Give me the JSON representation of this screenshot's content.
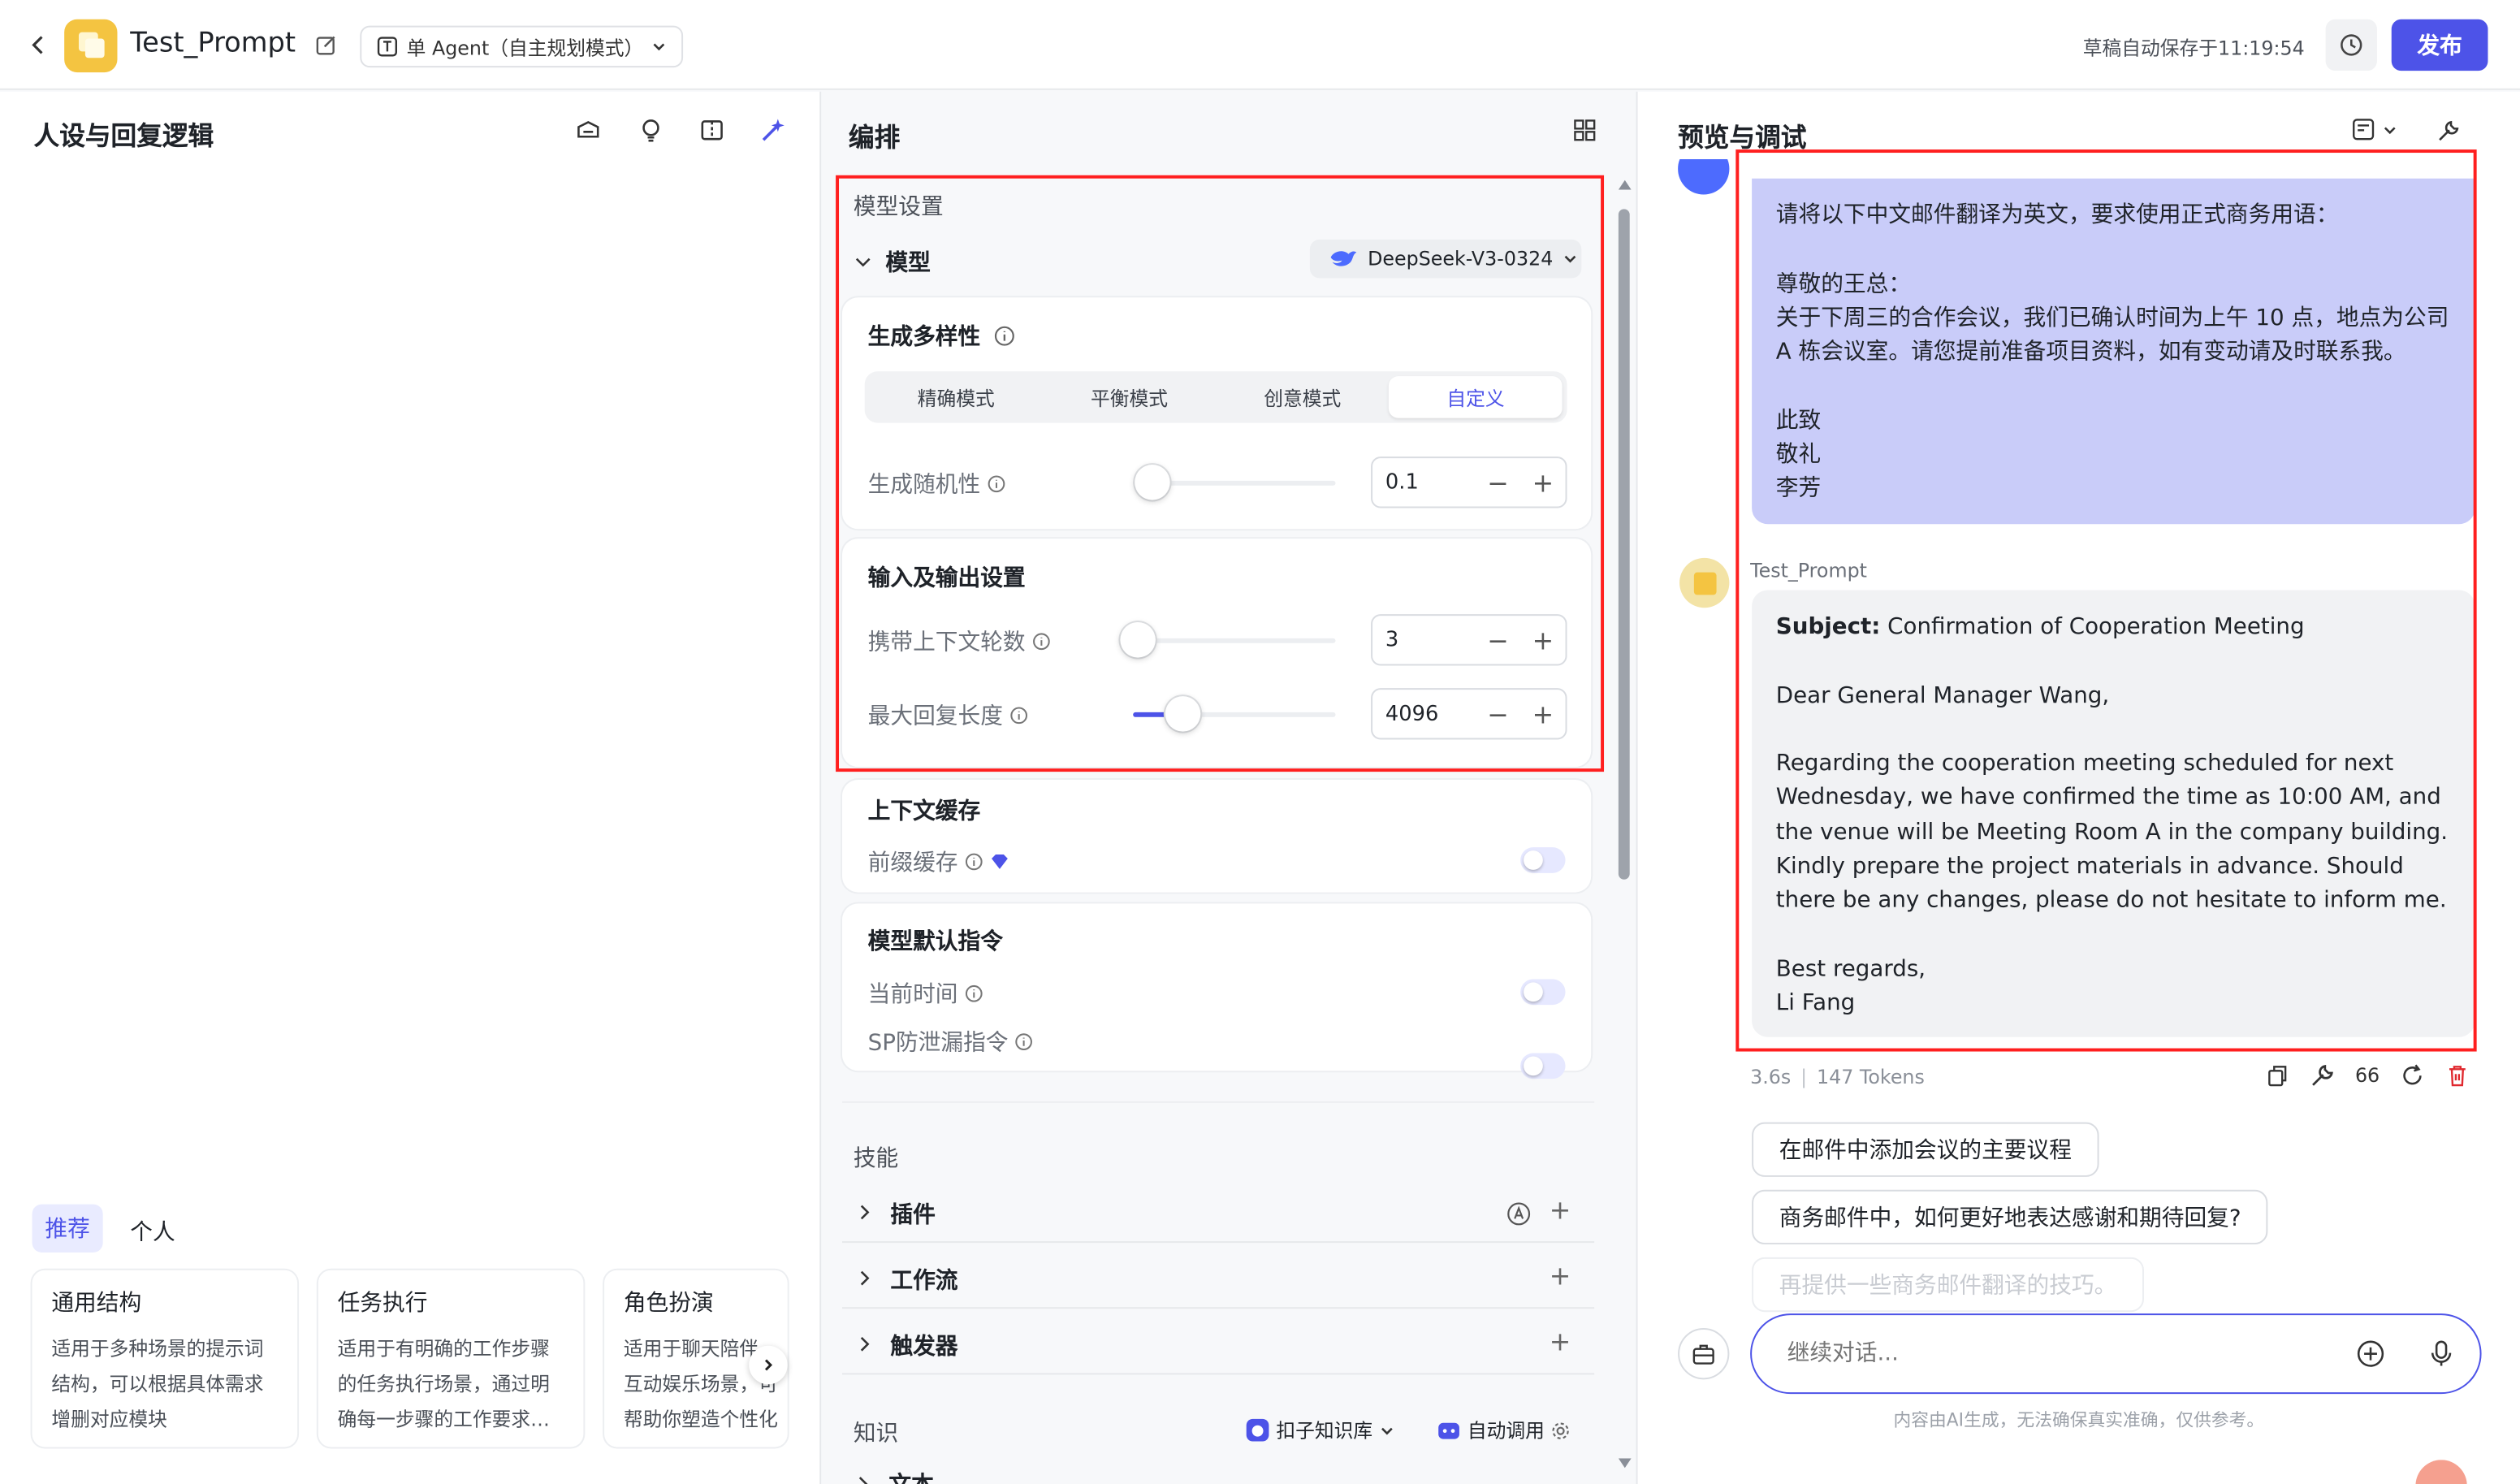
{
  "header": {
    "app_name": "Test_Prompt",
    "agent_mode": "单 Agent（自主规划模式）",
    "autosave": "草稿自动保存于11:19:54",
    "publish": "发布"
  },
  "left": {
    "title": "人设与回复逻辑",
    "tabs": [
      "推荐",
      "个人"
    ],
    "templates": [
      {
        "title": "通用结构",
        "desc": "适用于多种场景的提示词结构，可以根据具体需求增删对应模块"
      },
      {
        "title": "任务执行",
        "desc": "适用于有明确的工作步骤的任务执行场景，通过明确每一步骤的工作要求…"
      },
      {
        "title": "角色扮演",
        "desc": "适用于聊天陪伴、互动娱乐场景，可帮助你塑造个性化的人物…"
      }
    ]
  },
  "middle": {
    "title": "编排",
    "model_settings": "模型设置",
    "model_label": "模型",
    "model_name": "DeepSeek-V3-0324",
    "diversity": "生成多样性",
    "modes": [
      "精确模式",
      "平衡模式",
      "创意模式",
      "自定义"
    ],
    "randomness": "生成随机性",
    "randomness_value": "0.1",
    "randomness_level": 0.1,
    "io_settings": "输入及输出设置",
    "context_rounds": "携带上下文轮数",
    "context_rounds_value": "3",
    "max_reply": "最大回复长度",
    "max_reply_value": "4096",
    "max_reply_level": 0.25,
    "context_cache": "上下文缓存",
    "prefix_cache": "前缀缓存",
    "default_cmd": "模型默认指令",
    "current_time": "当前时间",
    "sp_leak": "SP防泄漏指令",
    "skills": "技能",
    "plugins": "插件",
    "workflow": "工作流",
    "trigger": "触发器",
    "knowledge": "知识",
    "kb_source": "扣子知识库",
    "auto_call": "自动调用",
    "text": "文本"
  },
  "right": {
    "title": "预览与调试",
    "user_message": "请将以下中文邮件翻译为英文，要求使用正式商务用语：\n\n尊敬的王总：\n关于下周三的合作会议，我们已确认时间为上午 10 点，地点为公司 A 栋会议室。请您提前准备项目资料，如有变动请及时联系我。\n\n此致\n敬礼\n李芳",
    "bot_name": "Test_Prompt",
    "reply_subject_label": "Subject:",
    "reply_subject": " Confirmation of Cooperation Meeting",
    "reply_body": "Dear General Manager Wang,\n\nRegarding the cooperation meeting scheduled for next Wednesday, we have confirmed the time as 10:00 AM, and the venue will be Meeting Room A in the company building. Kindly prepare the project materials in advance. Should there be any changes, please do not hesitate to inform me.\n\nBest regards,\nLi Fang",
    "latency": "3.6s",
    "tokens": "147 Tokens",
    "quote_count": "66",
    "suggestions": [
      "在邮件中添加会议的主要议程",
      "商务邮件中，如何更好地表达感谢和期待回复?",
      "再提供一些商务邮件翻译的技巧。"
    ],
    "input_placeholder": "继续对话...",
    "disclaimer": "内容由AI生成，无法确保真实准确，仅供参考。"
  },
  "colors": {
    "accent": "#4d53e8",
    "highlight": "#ff1f1f",
    "user_bubble": "#c9ccf9",
    "bot_bubble": "#f1f2f4"
  }
}
